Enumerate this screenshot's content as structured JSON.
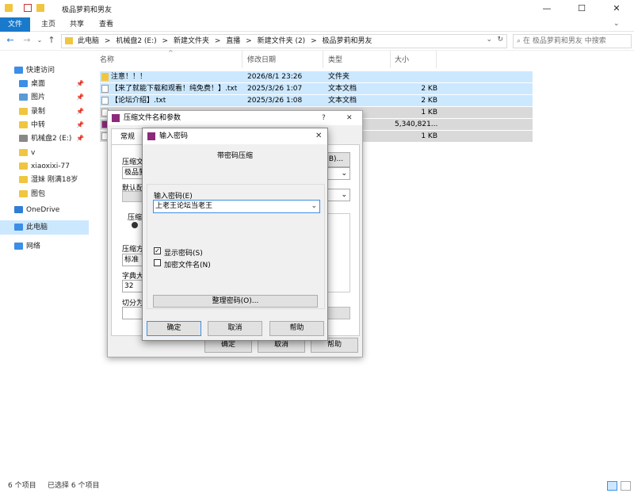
{
  "window": {
    "title": "极品萝莉和男友",
    "minimize": "—",
    "maximize": "☐",
    "close": "✕"
  },
  "ribbon": {
    "tabs": [
      "文件",
      "主页",
      "共享",
      "查看"
    ]
  },
  "address": {
    "crumbs": [
      "此电脑",
      ">",
      "机械盘2 (E:)",
      ">",
      "新建文件夹",
      ">",
      "直播",
      ">",
      "新建文件夹 (2)",
      ">",
      "极品萝莉和男友"
    ],
    "search_placeholder": "在 极品萝莉和男友 中搜索"
  },
  "nav": {
    "items": [
      {
        "label": "快速访问",
        "icon": "star-icon",
        "color": "#3c8ee6",
        "pinned": false
      },
      {
        "label": "桌面",
        "icon": "desktop-icon",
        "color": "#3c8ee6",
        "pinned": true
      },
      {
        "label": "图片",
        "icon": "pictures-icon",
        "color": "#5a9bd5",
        "pinned": true
      },
      {
        "label": "录制",
        "icon": "folder-icon",
        "color": "#f0c640",
        "pinned": true
      },
      {
        "label": "中转",
        "icon": "folder-icon",
        "color": "#f0c640",
        "pinned": true
      },
      {
        "label": "机械盘2 (E:)",
        "icon": "drive-icon",
        "color": "#888888",
        "pinned": true
      },
      {
        "label": "v",
        "icon": "folder-icon",
        "color": "#f0c640",
        "pinned": false
      },
      {
        "label": "xiaoxixi-77",
        "icon": "folder-icon",
        "color": "#f0c640",
        "pinned": false
      },
      {
        "label": "湿妹 刚满18岁",
        "icon": "folder-icon",
        "color": "#f0c640",
        "pinned": false
      },
      {
        "label": "图包",
        "icon": "folder-icon",
        "color": "#f0c640",
        "pinned": false
      },
      {
        "label": "OneDrive",
        "icon": "cloud-icon",
        "color": "#2f7fd6",
        "pinned": false
      },
      {
        "label": "此电脑",
        "icon": "computer-icon",
        "color": "#3c8ee6",
        "pinned": false
      },
      {
        "label": "网络",
        "icon": "network-icon",
        "color": "#3c8ee6",
        "pinned": false
      }
    ],
    "pin_glyph": "📌"
  },
  "files": {
    "headers": [
      "名称",
      "修改日期",
      "类型",
      "大小"
    ],
    "sort_glyph": "^",
    "rows": [
      {
        "name": "注意！！！",
        "date": "2026/8/1 23:26",
        "type": "文件夹",
        "size": ""
      },
      {
        "name": "【来了就能下载和观看！纯免费！】.txt",
        "date": "2025/3/26 1:07",
        "type": "文本文档",
        "size": "2 KB"
      },
      {
        "name": "【论坛介绍】.txt",
        "date": "2025/3/26 1:08",
        "type": "文本文档",
        "size": "2 KB"
      },
      {
        "name": "",
        "date": "",
        "type": "",
        "size": "1 KB"
      },
      {
        "name": "",
        "date": "",
        "type": "缩文件",
        "size": "5,340,821..."
      },
      {
        "name": "",
        "date": "",
        "type": "",
        "size": "1 KB"
      }
    ]
  },
  "status": {
    "count": "6 个项目",
    "selected": "已选择 6 个项目"
  },
  "archive_dialog": {
    "title": "压缩文件名和参数",
    "help": "?",
    "close": "✕",
    "tab": "常规",
    "labels": {
      "archive_name": "压缩文",
      "profile": "默认配",
      "format": "压缩文",
      "method": "压缩方",
      "dict": "字典大",
      "split": "切分为"
    },
    "values": {
      "archive_name": "极品萝",
      "method": "标准",
      "dict": "32"
    },
    "browse": "B)...",
    "ok": "确定",
    "cancel": "取消",
    "help_btn": "帮助"
  },
  "password_dialog": {
    "title": "输入密码",
    "close": "✕",
    "heading": "带密码压缩",
    "field_label": "输入密码(E)",
    "password": "上老王论坛当老王",
    "show_password": "显示密码(S)",
    "encrypt_names": "加密文件名(N)",
    "show_checked": "✓",
    "organize": "整理密码(O)...",
    "ok": "确定",
    "cancel": "取消",
    "help": "帮助"
  }
}
